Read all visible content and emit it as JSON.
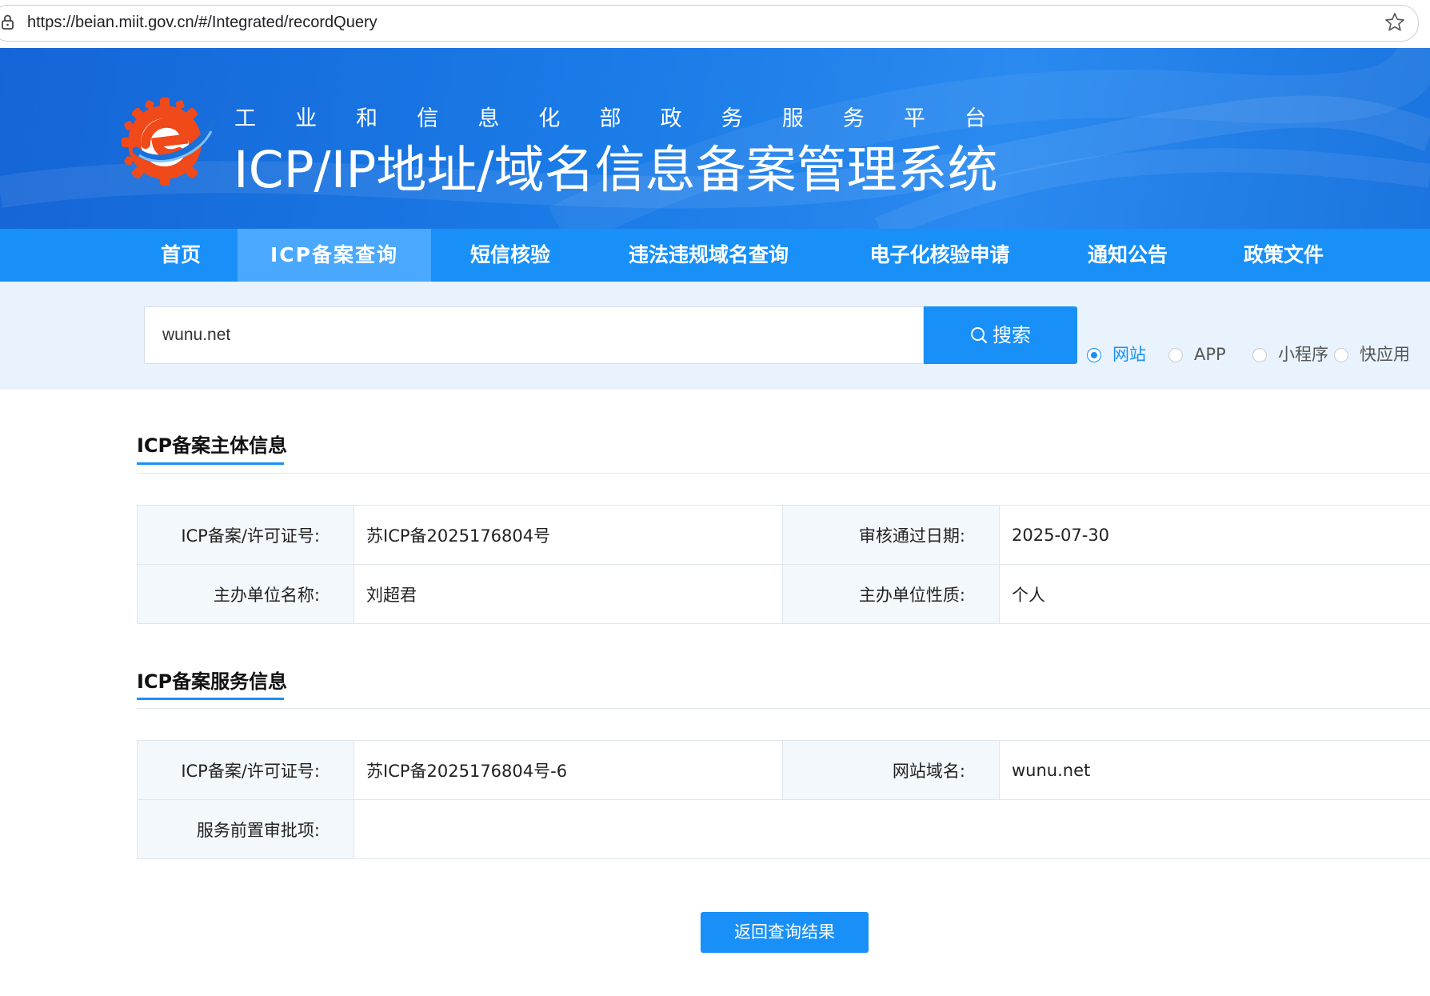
{
  "browser": {
    "url": "https://beian.miit.gov.cn/#/Integrated/recordQuery"
  },
  "header": {
    "ministry_chars": [
      "工",
      "业",
      "和",
      "信",
      "息",
      "化",
      "部",
      "政",
      "务",
      "服",
      "务",
      "平",
      "台"
    ],
    "system_title": "ICP/IP地址/域名信息备案管理系统"
  },
  "nav": {
    "items": [
      {
        "label": "首页",
        "active": false
      },
      {
        "label": "ICP备案查询",
        "active": true
      },
      {
        "label": "短信核验",
        "active": false
      },
      {
        "label": "违法违规域名查询",
        "active": false
      },
      {
        "label": "电子化核验申请",
        "active": false
      },
      {
        "label": "通知公告",
        "active": false
      },
      {
        "label": "政策文件",
        "active": false
      }
    ]
  },
  "search": {
    "value": "wunu.net",
    "button_label": "搜索",
    "options": [
      {
        "label": "网站",
        "checked": true
      },
      {
        "label": "APP",
        "checked": false
      },
      {
        "label": "小程序",
        "checked": false
      },
      {
        "label": "快应用",
        "checked": false
      }
    ]
  },
  "subject_info": {
    "title": "ICP备案主体信息",
    "rows": [
      {
        "label1": "ICP备案/许可证号:",
        "value1": "苏ICP备2025176804号",
        "label2": "审核通过日期:",
        "value2": "2025-07-30"
      },
      {
        "label1": "主办单位名称:",
        "value1": "刘超君",
        "label2": "主办单位性质:",
        "value2": "个人"
      }
    ]
  },
  "service_info": {
    "title": "ICP备案服务信息",
    "rows": [
      {
        "label1": "ICP备案/许可证号:",
        "value1": "苏ICP备2025176804号-6",
        "label2": "网站域名:",
        "value2": "wunu.net"
      },
      {
        "label1": "服务前置审批项:",
        "value1": ""
      }
    ]
  },
  "actions": {
    "back_label": "返回查询结果"
  },
  "colors": {
    "primary": "#1890f8",
    "nav_active": "#4aa8ff",
    "search_band": "#e9f3fd",
    "label_cell": "#f3f8fd",
    "logo_orange": "#f04a1a"
  }
}
